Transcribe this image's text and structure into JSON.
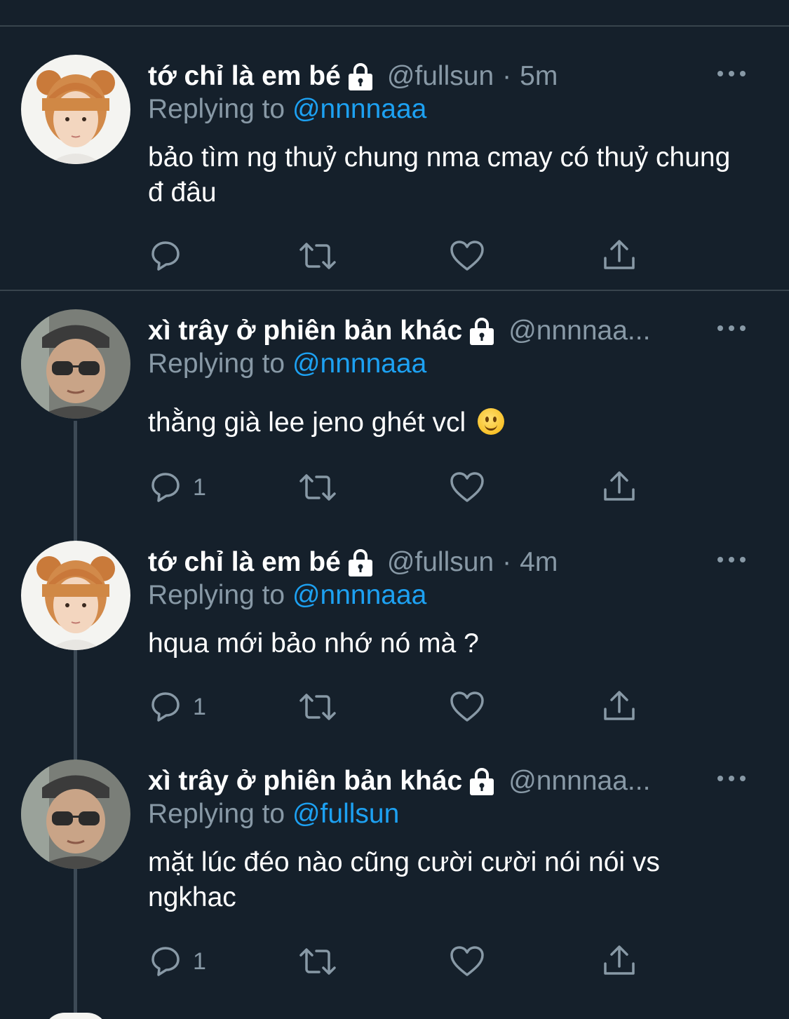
{
  "tweets": [
    {
      "name": "tớ chỉ là em bé",
      "handle": "@fullsun",
      "separator": "·",
      "time": "5m",
      "replying_prefix": "Replying to ",
      "replying_to": "@nnnnaaa",
      "text": "bảo tìm ng thuỷ chung nma cmay có thuỷ chung đ đâu",
      "reply_count": "",
      "avatar": "orange-hair-avatar",
      "locked": true
    },
    {
      "name": "xì trây ở phiên bản khác",
      "handle": "@nnnnaa...",
      "separator": "",
      "time": "",
      "replying_prefix": "Replying to ",
      "replying_to": "@nnnnaaa",
      "text": "thằng già lee jeno ghét vcl",
      "emoji": "slightly-smiling-face",
      "reply_count": "1",
      "avatar": "sunglasses-avatar",
      "locked": true
    },
    {
      "name": "tớ chỉ là em bé",
      "handle": "@fullsun",
      "separator": "·",
      "time": "4m",
      "replying_prefix": "Replying to ",
      "replying_to": "@nnnnaaa",
      "text": "hqua mới bảo nhớ nó mà ?",
      "reply_count": "1",
      "avatar": "orange-hair-avatar",
      "locked": true
    },
    {
      "name": "xì trây ở phiên bản khác",
      "handle": "@nnnnaa...",
      "separator": "",
      "time": "",
      "replying_prefix": "Replying to ",
      "replying_to": "@fullsun",
      "text": "mặt lúc đéo nào cũng cười cười nói nói vs ngkhac",
      "reply_count": "1",
      "avatar": "sunglasses-avatar",
      "locked": true
    }
  ],
  "colors": {
    "background": "#15202b",
    "divider": "#38444d",
    "secondary_text": "#8899a6",
    "link": "#1da1f2"
  },
  "icons": [
    "reply-icon",
    "retweet-icon",
    "like-icon",
    "share-icon",
    "more-icon",
    "lock-icon"
  ]
}
